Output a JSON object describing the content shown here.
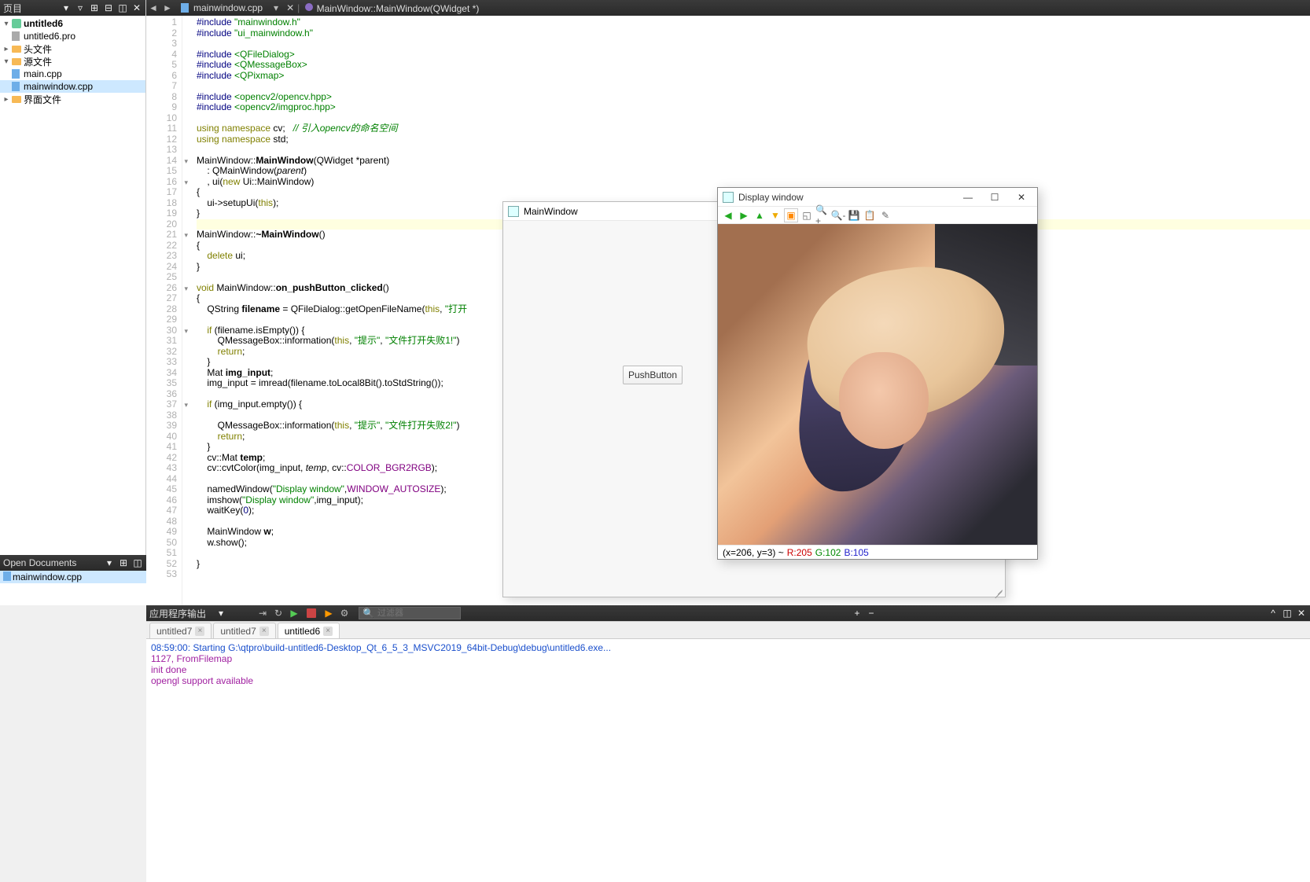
{
  "projectPanel": {
    "title": "页目"
  },
  "projectTree": {
    "root": "untitled6",
    "pro": "untitled6.pro",
    "headers": "头文件",
    "sources": "源文件",
    "main": "main.cpp",
    "mainwindow": "mainwindow.cpp",
    "forms": "界面文件"
  },
  "openDocs": {
    "title": "Open Documents",
    "item": "mainwindow.cpp"
  },
  "editorTab": "mainwindow.cpp",
  "breadcrumb": "MainWindow::MainWindow(QWidget *)",
  "code": {
    "lines": [
      {
        "n": 1,
        "h": "<span class='dir'>#include</span> <span class='str'>\"mainwindow.h\"</span>"
      },
      {
        "n": 2,
        "h": "<span class='dir'>#include</span> <span class='str'>\"ui_mainwindow.h\"</span>"
      },
      {
        "n": 3,
        "h": ""
      },
      {
        "n": 4,
        "h": "<span class='dir'>#include</span> <span class='inc'>&lt;QFileDialog&gt;</span>"
      },
      {
        "n": 5,
        "h": "<span class='dir'>#include</span> <span class='inc'>&lt;QMessageBox&gt;</span>"
      },
      {
        "n": 6,
        "h": "<span class='dir'>#include</span> <span class='inc'>&lt;QPixmap&gt;</span>"
      },
      {
        "n": 7,
        "h": ""
      },
      {
        "n": 8,
        "h": "<span class='dir'>#include</span> <span class='inc'>&lt;opencv2/opencv.hpp&gt;</span>"
      },
      {
        "n": 9,
        "h": "<span class='dir'>#include</span> <span class='inc'>&lt;opencv2/imgproc.hpp&gt;</span>"
      },
      {
        "n": 10,
        "h": ""
      },
      {
        "n": 11,
        "h": "<span class='kw'>using</span> <span class='kw'>namespace</span> cv;   <span class='cmt'>// 引入opencv的命名空间</span>"
      },
      {
        "n": 12,
        "h": "<span class='kw'>using</span> <span class='kw'>namespace</span> std;"
      },
      {
        "n": 13,
        "h": ""
      },
      {
        "n": 14,
        "fold": "▾",
        "h": "MainWindow::<span class='fn'>MainWindow</span>(QWidget *parent)"
      },
      {
        "n": 15,
        "h": "    : QMainWindow(<span style='font-style:italic'>parent</span>)"
      },
      {
        "n": 16,
        "fold": "▾",
        "h": "    , ui(<span class='kw'>new</span> Ui::MainWindow)"
      },
      {
        "n": 17,
        "h": "{"
      },
      {
        "n": 18,
        "h": "    ui-&gt;setupUi(<span class='kw'>this</span>);"
      },
      {
        "n": 19,
        "h": "}"
      },
      {
        "n": 20,
        "hl": true,
        "h": ""
      },
      {
        "n": 21,
        "fold": "▾",
        "h": "MainWindow::<span class='fn'>~MainWindow</span>()"
      },
      {
        "n": 22,
        "h": "{"
      },
      {
        "n": 23,
        "h": "    <span class='kw'>delete</span> ui;"
      },
      {
        "n": 24,
        "h": "}"
      },
      {
        "n": 25,
        "h": ""
      },
      {
        "n": 26,
        "fold": "▾",
        "h": "<span class='kw'>void</span> MainWindow::<span class='fn'>on_pushButton_clicked</span>()"
      },
      {
        "n": 27,
        "h": "{"
      },
      {
        "n": 28,
        "h": "    QString <span class='fn'>filename</span> = QFileDialog::getOpenFileName(<span class='kw'>this</span>, <span class='str'>\"打开</span>"
      },
      {
        "n": 29,
        "h": ""
      },
      {
        "n": 30,
        "fold": "▾",
        "h": "    <span class='kw'>if</span> (filename.isEmpty()) {"
      },
      {
        "n": 31,
        "h": "        QMessageBox::information(<span class='kw'>this</span>, <span class='str'>\"提示\"</span>, <span class='str'>\"文件打开失败1!\"</span>)"
      },
      {
        "n": 32,
        "h": "        <span class='kw'>return</span>;"
      },
      {
        "n": 33,
        "h": "    }"
      },
      {
        "n": 34,
        "h": "    Mat <span class='fn'>img_input</span>;"
      },
      {
        "n": 35,
        "h": "    img_input = imread(filename.toLocal8Bit().toStdString());"
      },
      {
        "n": 36,
        "h": ""
      },
      {
        "n": 37,
        "fold": "▾",
        "h": "    <span class='kw'>if</span> (img_input.empty()) {"
      },
      {
        "n": 38,
        "h": ""
      },
      {
        "n": 39,
        "h": "        QMessageBox::information(<span class='kw'>this</span>, <span class='str'>\"提示\"</span>, <span class='str'>\"文件打开失败2!\"</span>)"
      },
      {
        "n": 40,
        "h": "        <span class='kw'>return</span>;"
      },
      {
        "n": 41,
        "h": "    }"
      },
      {
        "n": 42,
        "h": "    cv::Mat <span class='fn'>temp</span>;"
      },
      {
        "n": 43,
        "h": "    cv::cvtColor(img_input, <span style='font-style:italic'>temp</span>, cv::<span class='const'>COLOR_BGR2RGB</span>);"
      },
      {
        "n": 44,
        "h": ""
      },
      {
        "n": 45,
        "h": "    namedWindow(<span class='str'>\"Display window\"</span>,<span class='const'>WINDOW_AUTOSIZE</span>);"
      },
      {
        "n": 46,
        "h": "    imshow(<span class='str'>\"Display window\"</span>,img_input);"
      },
      {
        "n": 47,
        "h": "    waitKey(<span class='num'>0</span>);"
      },
      {
        "n": 48,
        "h": ""
      },
      {
        "n": 49,
        "h": "    MainWindow <span class='fn'>w</span>;"
      },
      {
        "n": 50,
        "h": "    w.show();"
      },
      {
        "n": 51,
        "h": ""
      },
      {
        "n": 52,
        "h": "}"
      },
      {
        "n": 53,
        "h": ""
      }
    ]
  },
  "outputHeader": {
    "title": "应用程序输出",
    "filterPlaceholder": "过滤器"
  },
  "outputTabs": [
    {
      "label": "untitled7",
      "active": false
    },
    {
      "label": "untitled7",
      "active": false
    },
    {
      "label": "untitled6",
      "active": true
    }
  ],
  "output": {
    "l1": "08:59:00: Starting G:\\qtpro\\build-untitled6-Desktop_Qt_6_5_3_MSVC2019_64bit-Debug\\debug\\untitled6.exe...",
    "l2": "1127, FromFilemap",
    "l3": "init done",
    "l4": "opengl support available"
  },
  "mainWindow": {
    "title": "MainWindow",
    "button": "PushButton"
  },
  "displayWindow": {
    "title": "Display window",
    "statusCoord": "(x=206, y=3) ~",
    "statusR": "R:205",
    "statusG": "G:102",
    "statusB": "B:105"
  }
}
